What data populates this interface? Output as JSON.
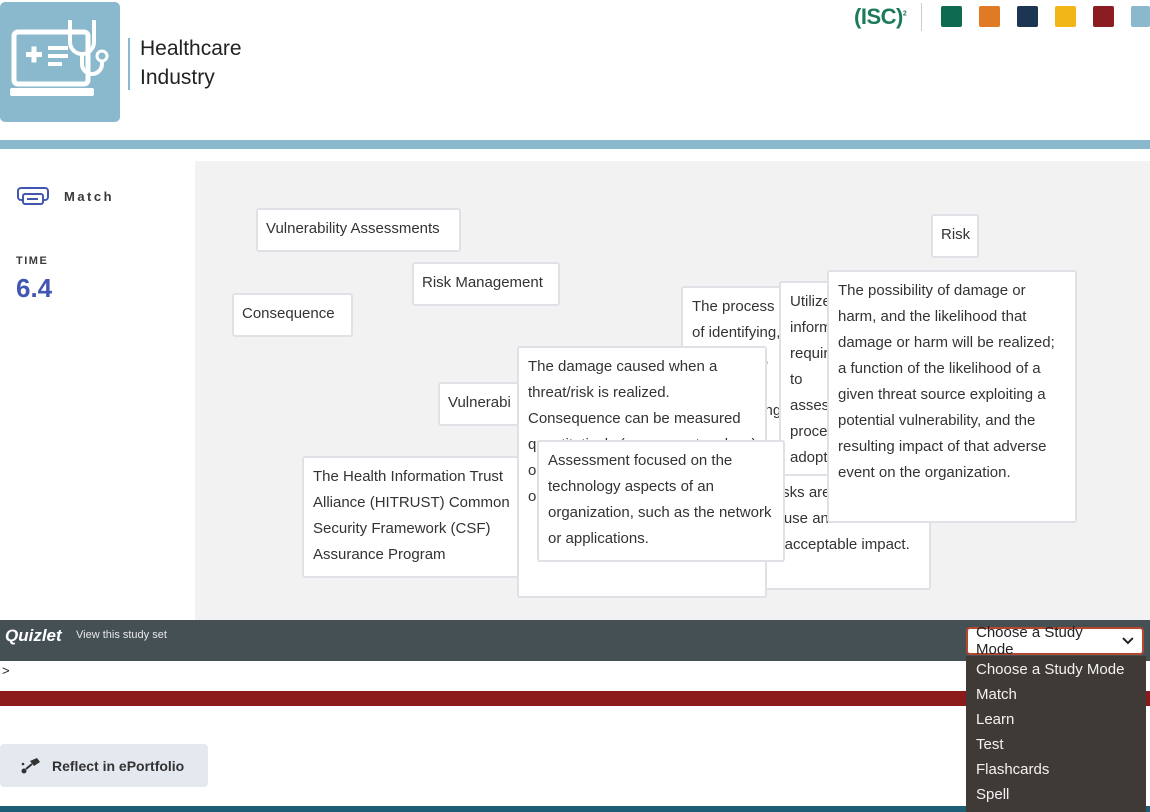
{
  "header": {
    "title_line1": "Healthcare",
    "title_line2": "Industry",
    "isc_logo": "(ISC)",
    "isc_sup": "2",
    "swatches": [
      "#0e6b4f",
      "#e07a25",
      "#1c3553",
      "#f2b618",
      "#8b1c22",
      "#8ab8cc"
    ]
  },
  "match": {
    "mode_label": "Match",
    "time_label": "TIME",
    "time_value": "6.4"
  },
  "cards": {
    "vulnerability_assessments": "Vulnerability Assessments",
    "risk": "Risk",
    "risk_management": "Risk Management",
    "consequence": "Consequence",
    "vulnerability_partial": "Vulnerabi",
    "hitrust": "The Health Information Trust Alliance (HITRUST) Common Security Framework (CSF) Assurance Program",
    "process_def": "The process of identifying, developing, and implementing",
    "utilize_def": "Utilize information required to assess processes adopted by organizations",
    "risk_def": "The possibility of damage or harm, and the likelihood that damage or harm will be realized; a function of the likelihood of a given threat source exploiting a potential vulnerability, and the resulting impact of that adverse event on the organization.",
    "consequence_def": "The damage caused when a threat/risk is realized. Consequence can be measured quantitatively (e.g., monetary loss) or qualitatively (e.g., loss of the organizations' reputation).",
    "assessment_def": "Assessment focused on the technology aspects of an organization, such as the network or applications.",
    "risks_def": "Risks are expected to cause an unacceptable impact."
  },
  "quizlet": {
    "brand": "Quizlet",
    "link": "View this study set",
    "select_value": "Choose a Study Mode",
    "options": [
      "Choose a Study Mode",
      "Match",
      "Learn",
      "Test",
      "Flashcards",
      "Spell"
    ]
  },
  "page": {
    "gt": ">",
    "reflect_label": "Reflect in ePortfolio"
  }
}
